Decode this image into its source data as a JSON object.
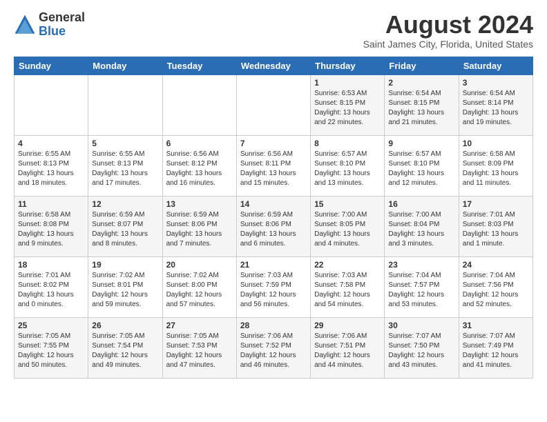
{
  "logo": {
    "general": "General",
    "blue": "Blue"
  },
  "title": "August 2024",
  "location": "Saint James City, Florida, United States",
  "days_of_week": [
    "Sunday",
    "Monday",
    "Tuesday",
    "Wednesday",
    "Thursday",
    "Friday",
    "Saturday"
  ],
  "weeks": [
    [
      {
        "day": "",
        "info": ""
      },
      {
        "day": "",
        "info": ""
      },
      {
        "day": "",
        "info": ""
      },
      {
        "day": "",
        "info": ""
      },
      {
        "day": "1",
        "info": "Sunrise: 6:53 AM\nSunset: 8:15 PM\nDaylight: 13 hours\nand 22 minutes."
      },
      {
        "day": "2",
        "info": "Sunrise: 6:54 AM\nSunset: 8:15 PM\nDaylight: 13 hours\nand 21 minutes."
      },
      {
        "day": "3",
        "info": "Sunrise: 6:54 AM\nSunset: 8:14 PM\nDaylight: 13 hours\nand 19 minutes."
      }
    ],
    [
      {
        "day": "4",
        "info": "Sunrise: 6:55 AM\nSunset: 8:13 PM\nDaylight: 13 hours\nand 18 minutes."
      },
      {
        "day": "5",
        "info": "Sunrise: 6:55 AM\nSunset: 8:13 PM\nDaylight: 13 hours\nand 17 minutes."
      },
      {
        "day": "6",
        "info": "Sunrise: 6:56 AM\nSunset: 8:12 PM\nDaylight: 13 hours\nand 16 minutes."
      },
      {
        "day": "7",
        "info": "Sunrise: 6:56 AM\nSunset: 8:11 PM\nDaylight: 13 hours\nand 15 minutes."
      },
      {
        "day": "8",
        "info": "Sunrise: 6:57 AM\nSunset: 8:10 PM\nDaylight: 13 hours\nand 13 minutes."
      },
      {
        "day": "9",
        "info": "Sunrise: 6:57 AM\nSunset: 8:10 PM\nDaylight: 13 hours\nand 12 minutes."
      },
      {
        "day": "10",
        "info": "Sunrise: 6:58 AM\nSunset: 8:09 PM\nDaylight: 13 hours\nand 11 minutes."
      }
    ],
    [
      {
        "day": "11",
        "info": "Sunrise: 6:58 AM\nSunset: 8:08 PM\nDaylight: 13 hours\nand 9 minutes."
      },
      {
        "day": "12",
        "info": "Sunrise: 6:59 AM\nSunset: 8:07 PM\nDaylight: 13 hours\nand 8 minutes."
      },
      {
        "day": "13",
        "info": "Sunrise: 6:59 AM\nSunset: 8:06 PM\nDaylight: 13 hours\nand 7 minutes."
      },
      {
        "day": "14",
        "info": "Sunrise: 6:59 AM\nSunset: 8:06 PM\nDaylight: 13 hours\nand 6 minutes."
      },
      {
        "day": "15",
        "info": "Sunrise: 7:00 AM\nSunset: 8:05 PM\nDaylight: 13 hours\nand 4 minutes."
      },
      {
        "day": "16",
        "info": "Sunrise: 7:00 AM\nSunset: 8:04 PM\nDaylight: 13 hours\nand 3 minutes."
      },
      {
        "day": "17",
        "info": "Sunrise: 7:01 AM\nSunset: 8:03 PM\nDaylight: 13 hours\nand 1 minute."
      }
    ],
    [
      {
        "day": "18",
        "info": "Sunrise: 7:01 AM\nSunset: 8:02 PM\nDaylight: 13 hours\nand 0 minutes."
      },
      {
        "day": "19",
        "info": "Sunrise: 7:02 AM\nSunset: 8:01 PM\nDaylight: 12 hours\nand 59 minutes."
      },
      {
        "day": "20",
        "info": "Sunrise: 7:02 AM\nSunset: 8:00 PM\nDaylight: 12 hours\nand 57 minutes."
      },
      {
        "day": "21",
        "info": "Sunrise: 7:03 AM\nSunset: 7:59 PM\nDaylight: 12 hours\nand 56 minutes."
      },
      {
        "day": "22",
        "info": "Sunrise: 7:03 AM\nSunset: 7:58 PM\nDaylight: 12 hours\nand 54 minutes."
      },
      {
        "day": "23",
        "info": "Sunrise: 7:04 AM\nSunset: 7:57 PM\nDaylight: 12 hours\nand 53 minutes."
      },
      {
        "day": "24",
        "info": "Sunrise: 7:04 AM\nSunset: 7:56 PM\nDaylight: 12 hours\nand 52 minutes."
      }
    ],
    [
      {
        "day": "25",
        "info": "Sunrise: 7:05 AM\nSunset: 7:55 PM\nDaylight: 12 hours\nand 50 minutes."
      },
      {
        "day": "26",
        "info": "Sunrise: 7:05 AM\nSunset: 7:54 PM\nDaylight: 12 hours\nand 49 minutes."
      },
      {
        "day": "27",
        "info": "Sunrise: 7:05 AM\nSunset: 7:53 PM\nDaylight: 12 hours\nand 47 minutes."
      },
      {
        "day": "28",
        "info": "Sunrise: 7:06 AM\nSunset: 7:52 PM\nDaylight: 12 hours\nand 46 minutes."
      },
      {
        "day": "29",
        "info": "Sunrise: 7:06 AM\nSunset: 7:51 PM\nDaylight: 12 hours\nand 44 minutes."
      },
      {
        "day": "30",
        "info": "Sunrise: 7:07 AM\nSunset: 7:50 PM\nDaylight: 12 hours\nand 43 minutes."
      },
      {
        "day": "31",
        "info": "Sunrise: 7:07 AM\nSunset: 7:49 PM\nDaylight: 12 hours\nand 41 minutes."
      }
    ]
  ]
}
